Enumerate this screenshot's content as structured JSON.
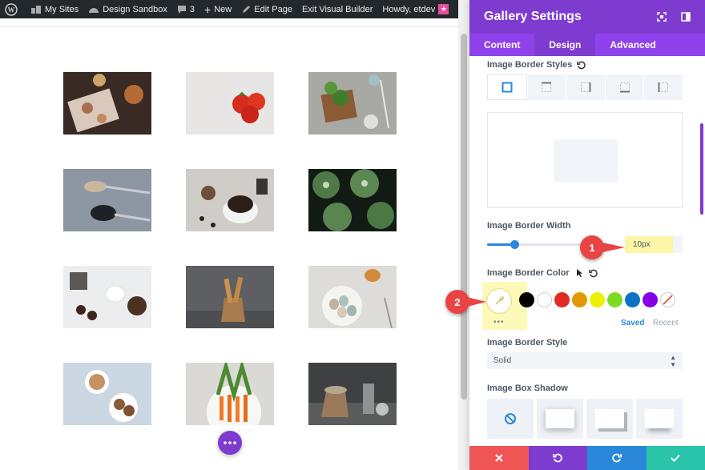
{
  "admin_bar": {
    "wp_icon": "wordpress-icon",
    "my_sites": "My Sites",
    "site_name": "Design Sandbox",
    "comments_count": "3",
    "new": "New",
    "edit_page": "Edit Page",
    "exit_builder": "Exit Visual Builder",
    "greeting": "Howdy, etdev"
  },
  "gallery": {
    "images": [
      "dessert",
      "tomatoes",
      "herbs",
      "spoons",
      "coffee",
      "squash",
      "cookies",
      "bread",
      "eggs",
      "tea",
      "carrots",
      "sack"
    ]
  },
  "panel": {
    "title": "Gallery Settings",
    "tabs": [
      "Content",
      "Design",
      "Advanced"
    ],
    "active_tab": "Design",
    "border_styles_label": "Image Border Styles",
    "border_width_label": "Image Border Width",
    "border_width_value": "10px",
    "border_color_label": "Image Border Color",
    "saved": "Saved",
    "recent": "Recent",
    "border_style_label": "Image Border Style",
    "border_style_value": "Solid",
    "box_shadow_label": "Image Box Shadow",
    "swatch_colors": [
      "#000000",
      "#ffffff",
      "#e02b20",
      "#e09900",
      "#edf000",
      "#7cda24",
      "#0c71c3",
      "#8300e9"
    ]
  },
  "annotations": [
    "1",
    "2"
  ],
  "colors": {
    "accent_purple": "#7e3bd0",
    "tab_bar": "#8f42ec",
    "cancel": "#ef5555",
    "undo": "#7e3bd0",
    "redo": "#2b87da",
    "save": "#29c4a9"
  }
}
